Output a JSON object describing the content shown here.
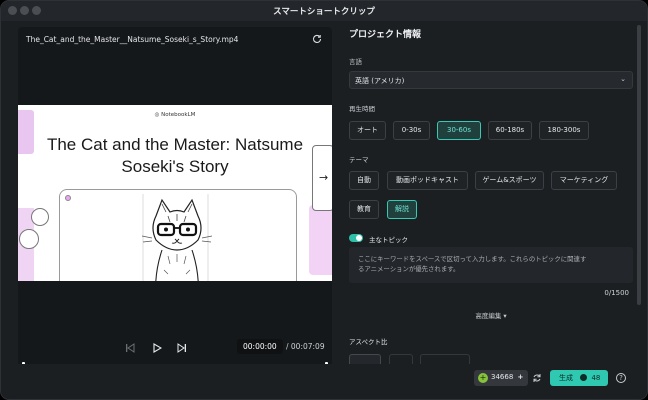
{
  "window": {
    "title": "スマートショートクリップ"
  },
  "preview": {
    "file_name": "The_Cat_and_the_Master__Natsume_Soseki_s_Story.mp4",
    "video": {
      "brand": "NotebookLM",
      "title_line1": "The Cat and the Master: Natsume",
      "title_line2": "Soseki's Story"
    },
    "current_time": "00:00:00",
    "total_time": "/ 00:07:09"
  },
  "project": {
    "heading": "プロジェクト情報",
    "language": {
      "label": "言語",
      "value": "英語 (アメリカ)"
    },
    "duration": {
      "label": "再生時間",
      "options": [
        "オート",
        "0-30s",
        "30-60s",
        "60-180s",
        "180-300s"
      ],
      "selected": "30-60s"
    },
    "theme": {
      "label": "テーマ",
      "options": [
        "自動",
        "動画ポッドキャスト",
        "ゲーム&スポーツ",
        "マーケティング",
        "教育",
        "解説"
      ],
      "selected": "解説"
    },
    "topics": {
      "label": "主なトピック",
      "enabled": true,
      "placeholder_line1": "ここにキーワードをスペースで区切って入力します。これらのトピックに関連す",
      "placeholder_line2": "るアニメーションが優先されます。",
      "count": "0/1500"
    },
    "advanced_label": "高度編集",
    "aspect_label": "アスペクト比"
  },
  "footer": {
    "credits": "34668",
    "generate_label": "生成",
    "generate_cost": "48"
  },
  "colors": {
    "accent": "#2fc8b1",
    "background": "#1c1f22"
  }
}
